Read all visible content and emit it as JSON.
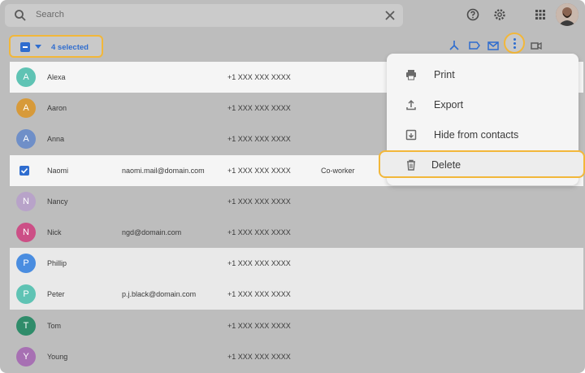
{
  "search": {
    "placeholder": "Search"
  },
  "selection": {
    "label": "4 selected"
  },
  "menu": {
    "items": [
      {
        "label": "Print",
        "icon": "printer-icon"
      },
      {
        "label": "Export",
        "icon": "export-icon"
      },
      {
        "label": "Hide from contacts",
        "icon": "archive-icon"
      },
      {
        "label": "Delete",
        "icon": "trash-icon"
      }
    ]
  },
  "contacts": [
    {
      "initial": "A",
      "name": "Alexa",
      "email": "",
      "phone": "+1 XXX XXX XXXX",
      "label": "",
      "color": "#5fc3b4",
      "selected": true,
      "bg": "white"
    },
    {
      "initial": "A",
      "name": "Aaron",
      "email": "",
      "phone": "+1 XXX XXX XXXX",
      "label": "",
      "color": "#d79a3a",
      "selected": false,
      "bg": "none"
    },
    {
      "initial": "A",
      "name": "Anna",
      "email": "",
      "phone": "+1 XXX XXX XXXX",
      "label": "",
      "color": "#6f8fc8",
      "selected": false,
      "bg": "none"
    },
    {
      "initial": "",
      "name": "Naomi",
      "email": "naomi.mail@domain.com",
      "phone": "+1 XXX XXX XXXX",
      "label": "Co-worker",
      "color": "",
      "selected": true,
      "bg": "white"
    },
    {
      "initial": "N",
      "name": "Nancy",
      "email": "",
      "phone": "+1 XXX XXX XXXX",
      "label": "",
      "color": "#b8a3c9",
      "selected": false,
      "bg": "none"
    },
    {
      "initial": "N",
      "name": "Nick",
      "email": "ngd@domain.com",
      "phone": "+1 XXX XXX XXXX",
      "label": "",
      "color": "#cc4f86",
      "selected": false,
      "bg": "none"
    },
    {
      "initial": "P",
      "name": "Phillip",
      "email": "",
      "phone": "+1 XXX XXX XXXX",
      "label": "",
      "color": "#4a8de0",
      "selected": true,
      "bg": "light"
    },
    {
      "initial": "P",
      "name": "Peter",
      "email": "p.j.black@domain.com",
      "phone": "+1 XXX XXX XXXX",
      "label": "",
      "color": "#5fc3b4",
      "selected": true,
      "bg": "light"
    },
    {
      "initial": "T",
      "name": "Tom",
      "email": "",
      "phone": "+1 XXX XXX XXXX",
      "label": "",
      "color": "#2f8c6a",
      "selected": false,
      "bg": "none"
    },
    {
      "initial": "Y",
      "name": "Young",
      "email": "",
      "phone": "+1 XXX XXX XXXX",
      "label": "",
      "color": "#a770b3",
      "selected": false,
      "bg": "none"
    }
  ],
  "colors": {
    "accent": "#2f6dcf",
    "highlight": "#f2b73a"
  }
}
